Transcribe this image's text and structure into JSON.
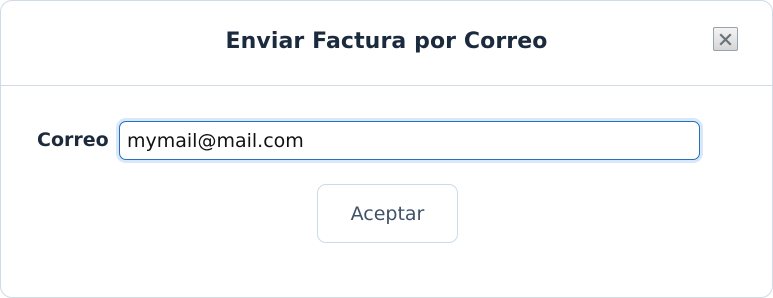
{
  "dialog": {
    "title": "Enviar Factura por Correo",
    "close_icon": "close-icon"
  },
  "form": {
    "email_label": "Correo",
    "email_value": "mymail@mail.com"
  },
  "actions": {
    "accept_label": "Aceptar"
  },
  "colors": {
    "title_text": "#1b2a3d",
    "input_border": "#2b6fb8",
    "button_text": "#3f5266",
    "divider": "#cfdbe6"
  }
}
